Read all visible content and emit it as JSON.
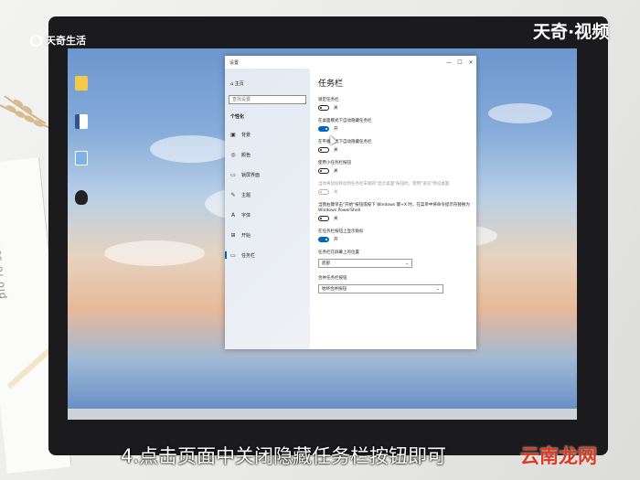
{
  "brand_left": "天奇生活",
  "brand_right": "天奇·视频",
  "caption": "4.点击页面中关闭隐藏任务栏按钮即可",
  "watermark": "云南龙网",
  "notebook_text": "plo fo ssaueddey",
  "colors": {
    "accent": "#0067c0",
    "caption_watermark": "#d93a20"
  },
  "window": {
    "title": "设置",
    "controls": {
      "minimize": "—",
      "maximize": "☐",
      "close": "✕"
    },
    "nav": {
      "home_label": "主页",
      "search_placeholder": "查找设置",
      "section": "个性化",
      "items": [
        {
          "label": "背景",
          "icon": "image-icon"
        },
        {
          "label": "颜色",
          "icon": "palette-icon"
        },
        {
          "label": "锁屏界面",
          "icon": "lock-screen-icon"
        },
        {
          "label": "主题",
          "icon": "brush-icon"
        },
        {
          "label": "字体",
          "icon": "font-icon"
        },
        {
          "label": "开始",
          "icon": "start-icon"
        },
        {
          "label": "任务栏",
          "icon": "taskbar-icon",
          "active": true
        }
      ]
    },
    "content": {
      "title": "任务栏",
      "options": [
        {
          "label": "锁定任务栏",
          "state": "关",
          "on": false,
          "disabled": false
        },
        {
          "label": "在桌面模式下自动隐藏任务栏",
          "state": "开",
          "on": true,
          "disabled": false
        },
        {
          "label": "在平板模式下自动隐藏任务栏",
          "state": "关",
          "on": false,
          "disabled": false
        },
        {
          "label": "使用小任务栏按钮",
          "state": "关",
          "on": false,
          "disabled": false
        },
        {
          "label": "当你将鼠标移动到任务栏末端的\"显示桌面\"按钮时，使用\"速览\"预览桌面",
          "state": "关",
          "on": false,
          "disabled": true
        },
        {
          "label": "当我右键单击\"开始\"按钮或按下 Windows 键+X 时，在菜单中将命令提示符替换为 Windows PowerShell",
          "state": "关",
          "on": false,
          "disabled": false
        },
        {
          "label": "在任务栏按钮上显示角标",
          "state": "开",
          "on": true,
          "disabled": false
        }
      ],
      "position_label": "任务栏在屏幕上的位置",
      "position_value": "底部",
      "combine_label": "合并任务栏按钮",
      "combine_value": "始终合并按钮"
    }
  },
  "desktop_icons": [
    "folder-icon",
    "word-doc-icon",
    "computer-icon",
    "qq-icon"
  ]
}
